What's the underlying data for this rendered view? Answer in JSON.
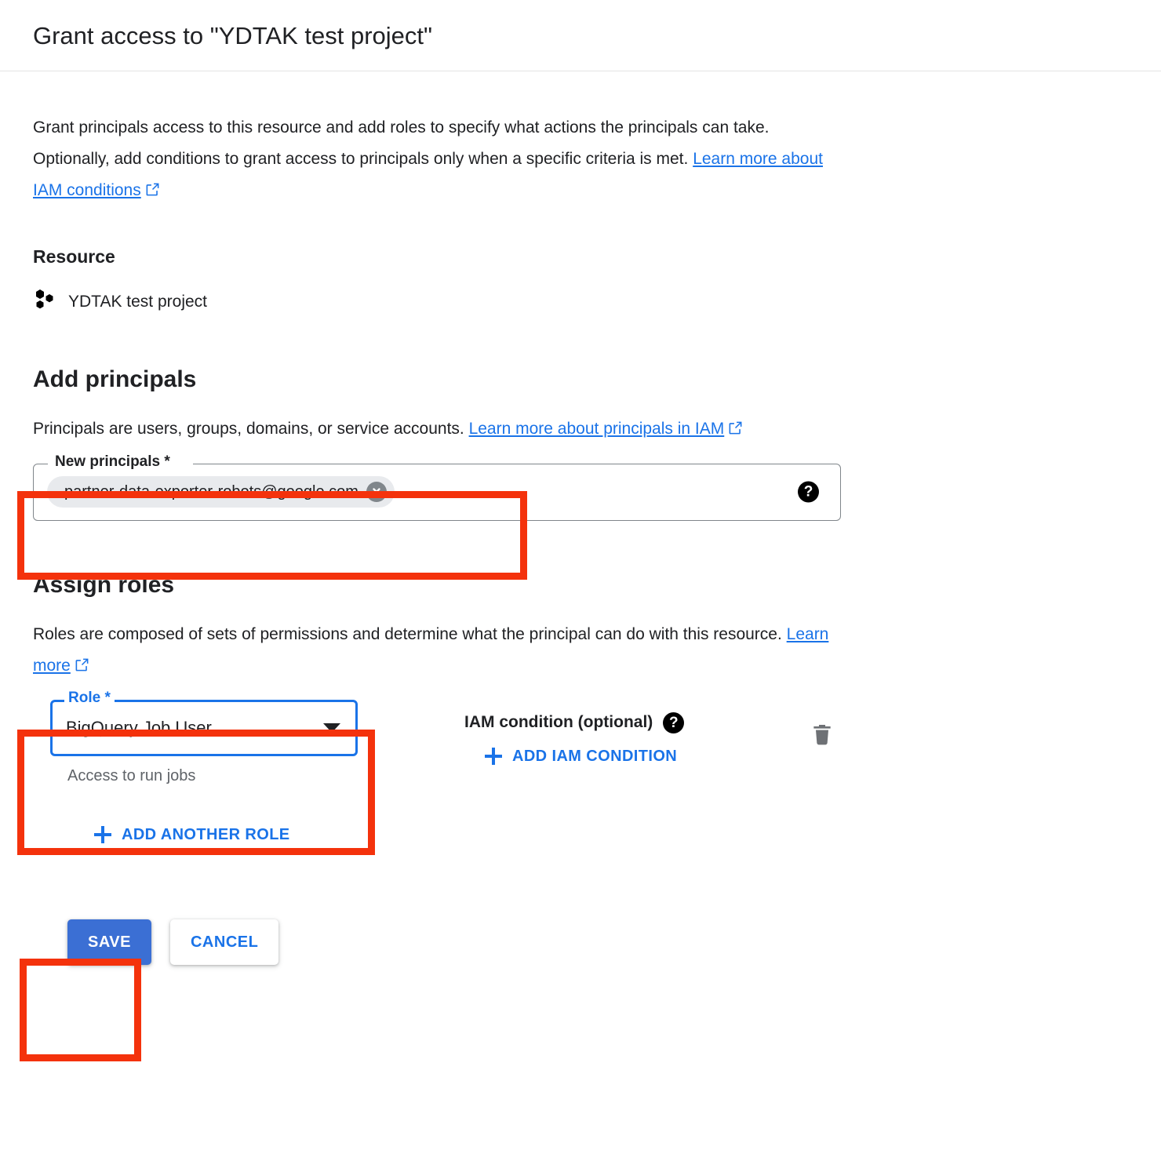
{
  "header": {
    "title": "Grant access to \"YDTAK test project\""
  },
  "intro": {
    "text": "Grant principals access to this resource and add roles to specify what actions the principals can take. Optionally, add conditions to grant access to principals only when a specific criteria is met. ",
    "link_label": "Learn more about IAM conditions",
    "external_icon": "external-link-icon"
  },
  "resource": {
    "heading": "Resource",
    "icon": "project-hexagons-icon",
    "name": "YDTAK test project"
  },
  "add_principals": {
    "heading": "Add principals",
    "desc_text": "Principals are users, groups, domains, or service accounts. ",
    "desc_link": "Learn more about principals in IAM",
    "field_label": "New principals *",
    "chip_value": "partner-data-exporter-robots@google.com",
    "chip_remove_icon": "close-circle-icon",
    "help_icon": "help-icon",
    "help_glyph": "?"
  },
  "assign_roles": {
    "heading": "Assign roles",
    "desc_text": "Roles are composed of sets of permissions and determine what the principal can do with this resource. ",
    "desc_link": "Learn more",
    "role_label": "Role *",
    "role_value": "BigQuery Job User",
    "role_hint": "Access to run jobs",
    "dropdown_icon": "chevron-down-icon",
    "condition_label": "IAM condition (optional)",
    "condition_help_glyph": "?",
    "add_condition_label": "ADD IAM CONDITION",
    "delete_icon": "trash-icon",
    "add_another_role_label": "ADD ANOTHER ROLE"
  },
  "actions": {
    "save_label": "SAVE",
    "cancel_label": "CANCEL"
  },
  "colors": {
    "accent_blue": "#1a73e8",
    "save_blue": "#3b6fd4",
    "annotation_red": "#f4320c",
    "chip_grey": "#e8eaed",
    "hint_grey": "#5f6368"
  }
}
